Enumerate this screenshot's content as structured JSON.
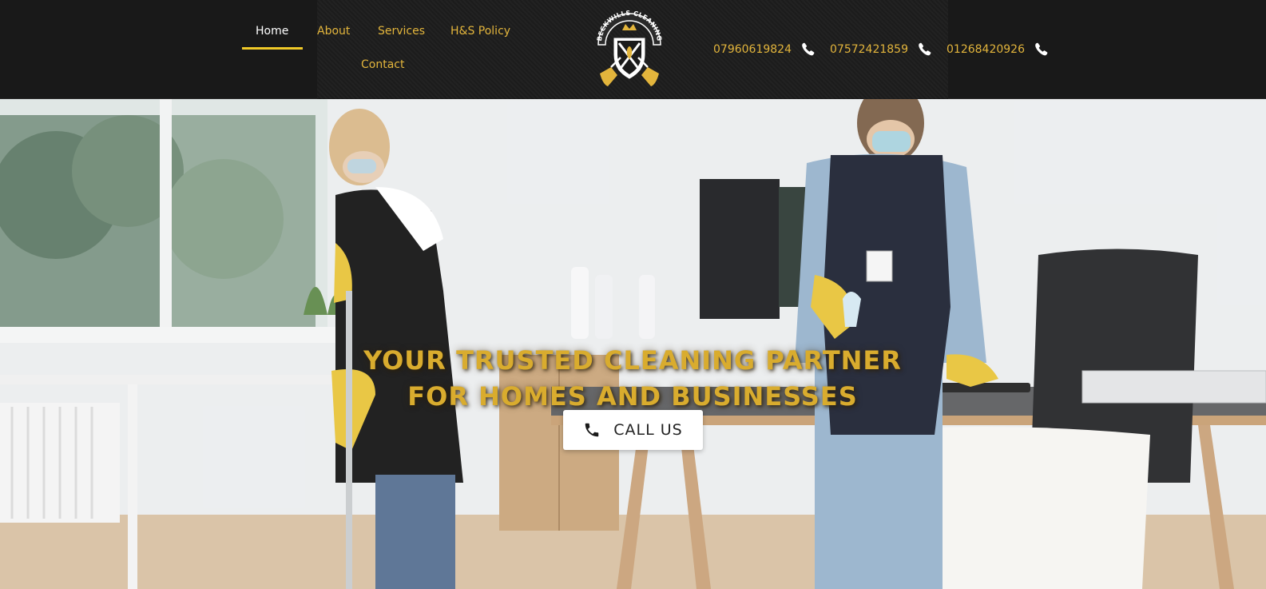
{
  "brand": {
    "logo_text": "BECKWILLS CLEANING",
    "accent_color": "#e3b53c",
    "underline_color": "#f0c928",
    "header_bg": "#191919"
  },
  "nav": {
    "items": [
      {
        "label": "Home",
        "active": true
      },
      {
        "label": "About",
        "active": false
      },
      {
        "label": "Services",
        "active": false
      },
      {
        "label": "H&S Policy",
        "active": false
      },
      {
        "label": "Contact",
        "active": false
      }
    ]
  },
  "phones": [
    {
      "number": "07960619824",
      "icon": "phone-icon"
    },
    {
      "number": "07572421859",
      "icon": "phone-icon"
    },
    {
      "number": "01268420926",
      "icon": "phone-icon"
    }
  ],
  "hero": {
    "headline_line1": "YOUR TRUSTED CLEANING PARTNER",
    "headline_line2": "FOR HOMES AND BUSINESSES",
    "headline_color": "#d9ac2e",
    "cta_label": "CALL US",
    "cta_icon": "phone-icon",
    "image": "two-cleaners-in-office-photo"
  }
}
